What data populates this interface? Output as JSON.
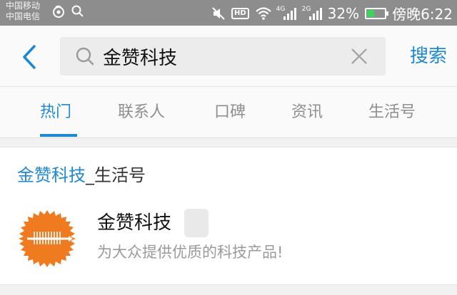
{
  "status_bar": {
    "carrier_1": "中国移动",
    "carrier_2": "中国电信",
    "hd": "HD",
    "net_1": "4G",
    "net_2": "2G",
    "battery": "32%",
    "time": "傍晚6:22"
  },
  "search": {
    "query": "金赞科技",
    "placeholder": "",
    "submit_label": "搜索"
  },
  "tabs": [
    {
      "label": "热门"
    },
    {
      "label": "联系人"
    },
    {
      "label": "口碑"
    },
    {
      "label": "资讯"
    },
    {
      "label": "生活号"
    }
  ],
  "section": {
    "highlight": "金赞科技",
    "suffix": "_生活号"
  },
  "result": {
    "name": "金赞科技",
    "description": "为大众提供优质的科技产品!"
  },
  "colors": {
    "accent": "#1f88d2",
    "status_bar": "#8d8d8d",
    "logo": "#f07a1f"
  },
  "icons": {
    "back": "back-arrow-icon",
    "search": "search-icon",
    "clear": "clear-icon"
  }
}
